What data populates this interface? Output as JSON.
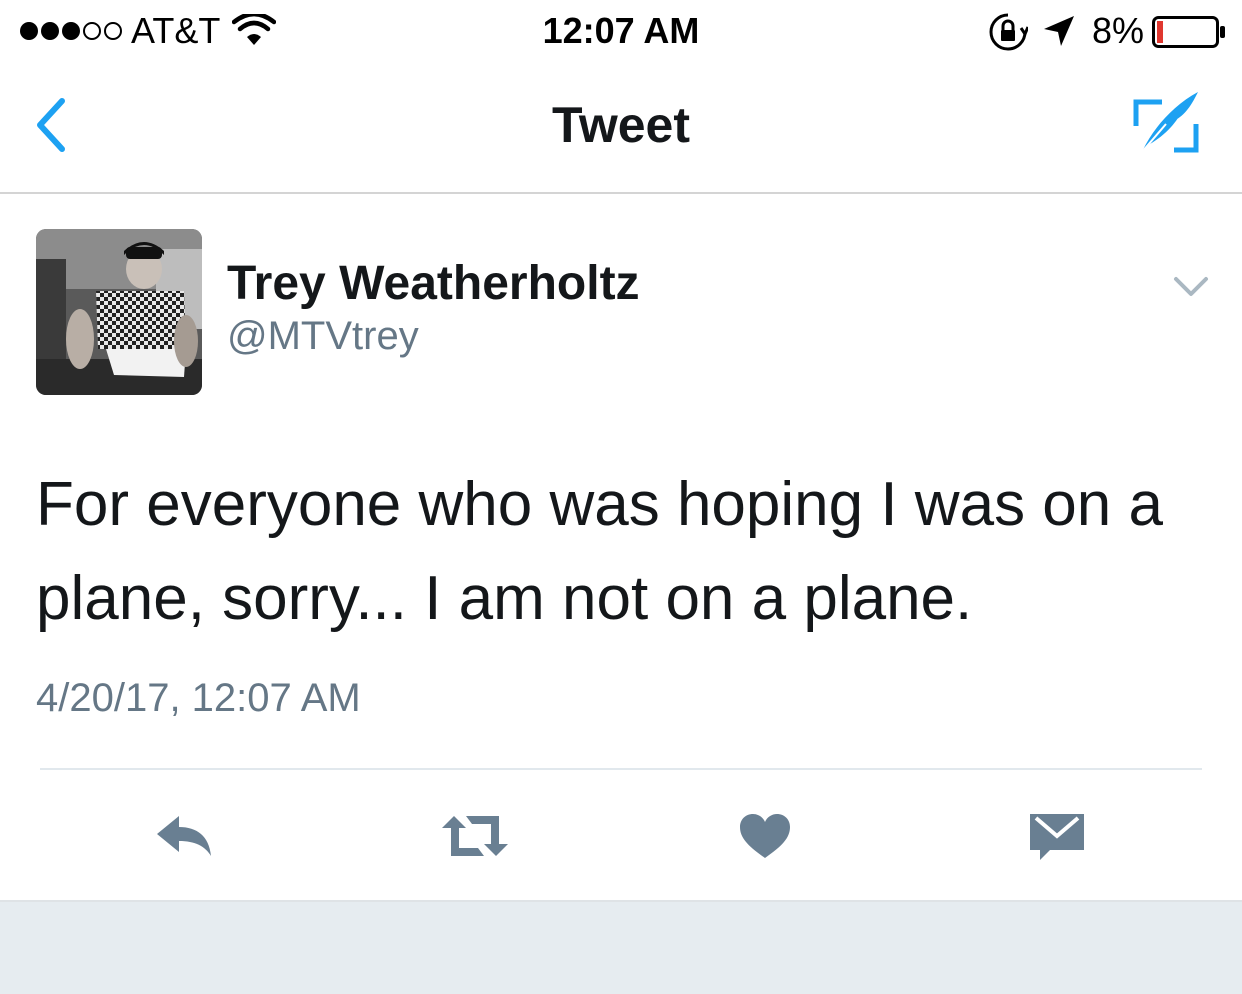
{
  "status_bar": {
    "carrier": "AT&T",
    "time": "12:07 AM",
    "battery": "8%",
    "signal_full_dots": 3,
    "signal_empty_dots": 2
  },
  "nav": {
    "title": "Tweet",
    "back_icon": "chevron-left-icon",
    "compose_icon": "compose-tweet-icon"
  },
  "tweet": {
    "display_name": "Trey Weatherholtz",
    "username": "@MTVtrey",
    "text": "For everyone who was hoping I was on a plane, sorry... I am not on a plane.",
    "timestamp": "4/20/17, 12:07 AM"
  },
  "actions": [
    {
      "name": "reply",
      "icon": "reply-icon"
    },
    {
      "name": "retweet",
      "icon": "retweet-icon"
    },
    {
      "name": "like",
      "icon": "heart-icon"
    },
    {
      "name": "direct-message",
      "icon": "envelope-icon"
    }
  ],
  "colors": {
    "accent": "#1da1f2",
    "text": "#14171a",
    "secondary": "#657786",
    "action_icon": "#697f92",
    "battery_low": "#e0372f"
  }
}
